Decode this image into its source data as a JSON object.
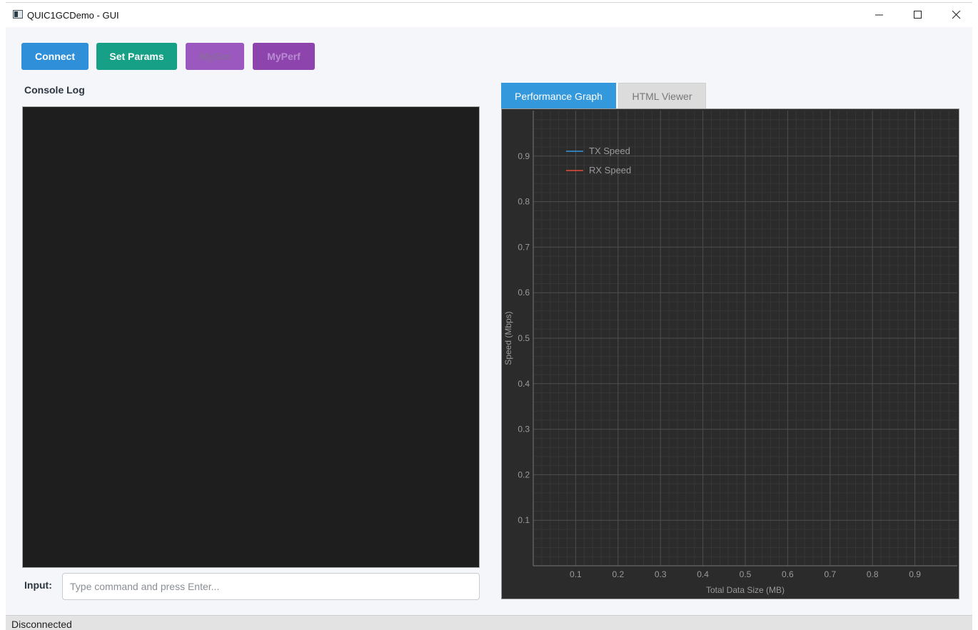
{
  "window": {
    "title": "QUIC1GCDemo - GUI"
  },
  "toolbar": {
    "connect_label": "Connect",
    "set_params_label": "Set Params",
    "myget_label": "MyGet",
    "myperf_label": "MyPerf"
  },
  "console": {
    "title": "Console Log"
  },
  "input": {
    "label": "Input:",
    "placeholder": "Type command and press Enter..."
  },
  "tabs": [
    {
      "label": "Performance Graph",
      "active": true
    },
    {
      "label": "HTML Viewer",
      "active": false
    }
  ],
  "chart_data": {
    "type": "line",
    "title": "",
    "xlabel": "Total Data Size (MB)",
    "ylabel": "Speed (Mbps)",
    "xlim": [
      0,
      1
    ],
    "ylim": [
      0,
      1
    ],
    "xticks": [
      0.1,
      0.2,
      0.3,
      0.4,
      0.5,
      0.6,
      0.7,
      0.8,
      0.9
    ],
    "yticks": [
      0.1,
      0.2,
      0.3,
      0.4,
      0.5,
      0.6,
      0.7,
      0.8,
      0.9
    ],
    "grid": true,
    "legend_position": "top-left",
    "series": [
      {
        "name": "TX Speed",
        "color": "#3498db",
        "x": [],
        "y": []
      },
      {
        "name": "RX Speed",
        "color": "#e74c3c",
        "x": [],
        "y": []
      }
    ]
  },
  "status": {
    "text": "Disconnected"
  }
}
